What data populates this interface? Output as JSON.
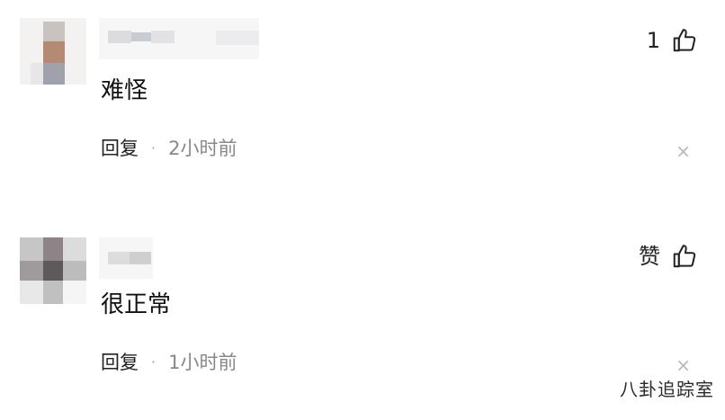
{
  "comments": [
    {
      "like_label": "1",
      "content": "难怪",
      "reply_label": "回复",
      "separator": "·",
      "time": "2小时前",
      "close_symbol": "×"
    },
    {
      "like_label": "赞",
      "content": "很正常",
      "reply_label": "回复",
      "separator": "·",
      "time": "1小时前",
      "close_symbol": "×"
    }
  ],
  "watermark": "八卦追踪室",
  "icons": {
    "like": "thumbs-up-icon",
    "close": "close-icon"
  },
  "colors": {
    "text": "#222222",
    "muted": "#888888",
    "close": "#b8b8b8"
  }
}
